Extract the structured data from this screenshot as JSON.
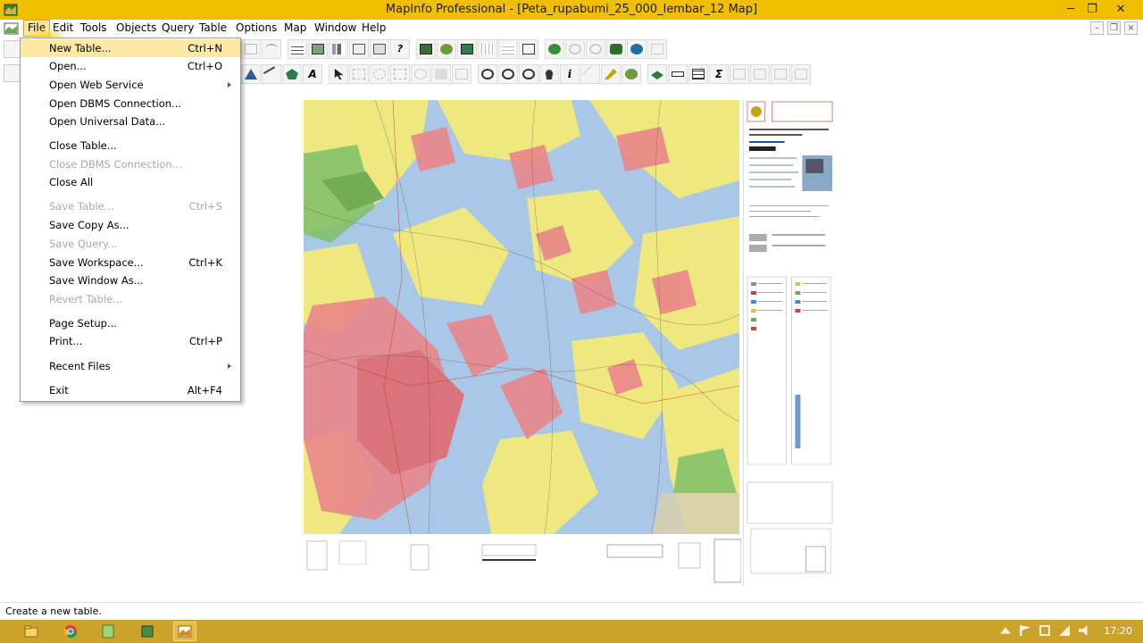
{
  "window": {
    "title": "MapInfo Professional - [Peta_rupabumi_25_000_lembar_12 Map]",
    "minimize_label": "─",
    "restore_label": "❐",
    "close_label": "✕"
  },
  "menubar": {
    "items": [
      {
        "label": "File"
      },
      {
        "label": "Edit"
      },
      {
        "label": "Tools"
      },
      {
        "label": "Objects"
      },
      {
        "label": "Query"
      },
      {
        "label": "Table"
      },
      {
        "label": "Options"
      },
      {
        "label": "Map"
      },
      {
        "label": "Window"
      },
      {
        "label": "Help"
      }
    ],
    "mdi_minimize": "–",
    "mdi_restore": "❐",
    "mdi_close": "×"
  },
  "file_menu": {
    "items": [
      {
        "label": "New Table...",
        "shortcut": "Ctrl+N",
        "enabled": true
      },
      {
        "label": "Open...",
        "shortcut": "Ctrl+O",
        "enabled": true
      },
      {
        "label": "Open Web Service",
        "shortcut": "",
        "enabled": true,
        "submenu": true
      },
      {
        "label": "Open DBMS Connection...",
        "shortcut": "",
        "enabled": true
      },
      {
        "label": "Open Universal Data...",
        "shortcut": "",
        "enabled": true
      },
      {
        "label": "Close Table...",
        "shortcut": "",
        "enabled": true
      },
      {
        "label": "Close DBMS Connection...",
        "shortcut": "",
        "enabled": false
      },
      {
        "label": "Close All",
        "shortcut": "",
        "enabled": true
      },
      {
        "label": "Save Table...",
        "shortcut": "Ctrl+S",
        "enabled": false
      },
      {
        "label": "Save Copy As...",
        "shortcut": "",
        "enabled": true
      },
      {
        "label": "Save Query...",
        "shortcut": "",
        "enabled": false
      },
      {
        "label": "Save Workspace...",
        "shortcut": "Ctrl+K",
        "enabled": true
      },
      {
        "label": "Save Window As...",
        "shortcut": "",
        "enabled": true
      },
      {
        "label": "Revert Table...",
        "shortcut": "",
        "enabled": false
      },
      {
        "label": "Page Setup...",
        "shortcut": "",
        "enabled": true
      },
      {
        "label": "Print...",
        "shortcut": "Ctrl+P",
        "enabled": true
      },
      {
        "label": "Recent Files",
        "shortcut": "",
        "enabled": true,
        "submenu": true
      },
      {
        "label": "Exit",
        "shortcut": "Alt+F4",
        "enabled": true
      }
    ]
  },
  "statusbar": {
    "message": "Create a new table."
  },
  "taskbar": {
    "clock": "17:20"
  },
  "colors": {
    "title_bar": "#f0c000",
    "taskbar": "#cba22a",
    "menu_highlight": "#ffe89a",
    "map_yellow": "#f2ea7a",
    "map_blue": "#a9c8e8",
    "map_red": "#e9868a",
    "map_green": "#7fbf6a"
  }
}
